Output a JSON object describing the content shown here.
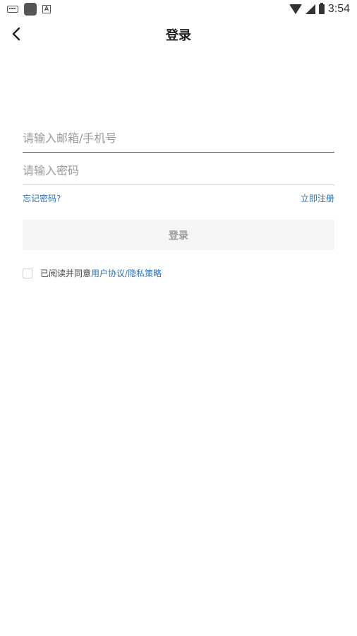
{
  "status_bar": {
    "time": "3:54",
    "icons": [
      "keyboard-icon",
      "app-icon",
      "a-icon",
      "wifi-icon",
      "cell-signal-icon",
      "battery-icon"
    ]
  },
  "header": {
    "title": "登录",
    "back_icon": "chevron-left-icon"
  },
  "form": {
    "email_placeholder": "请输入邮箱/手机号",
    "email_value": "",
    "password_placeholder": "请输入密码",
    "password_value": "",
    "forgot_password": "忘记密码?",
    "register": "立即注册",
    "login_button": "登录"
  },
  "agreement": {
    "prefix": "已阅读并同意",
    "user_agreement": "用户协议",
    "separator": "/",
    "privacy_policy": "隐私策略",
    "checked": false
  },
  "colors": {
    "accent": "#2c72b9",
    "placeholder": "#9a9a9a",
    "button_bg": "#f5f5f5"
  }
}
